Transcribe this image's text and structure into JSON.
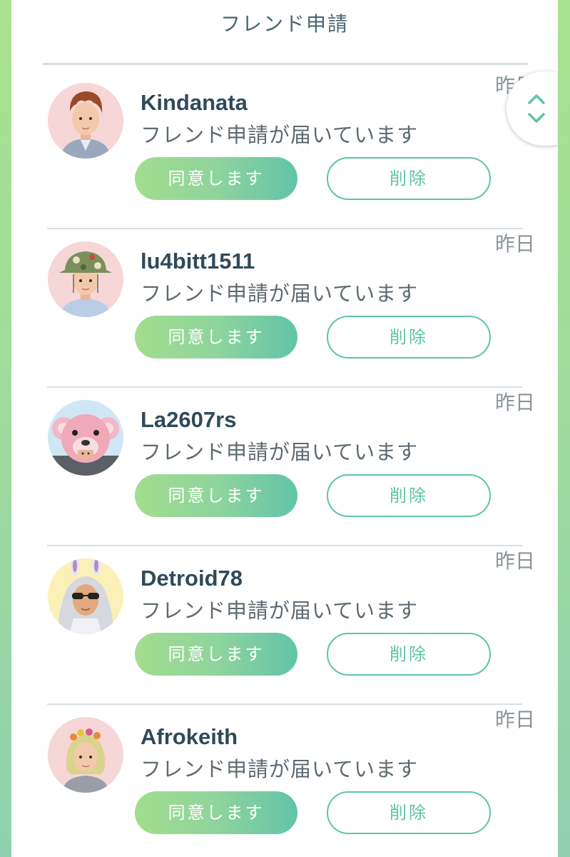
{
  "header": {
    "title": "フレンド申請"
  },
  "requests": [
    {
      "username": "Kindanata",
      "message": "フレンド申請が届いています",
      "time": "昨日",
      "accept_label": "同意します",
      "delete_label": "削除",
      "avatar_bg": "#f6d6d6"
    },
    {
      "username": "lu4bitt1511",
      "message": "フレンド申請が届いています",
      "time": "昨日",
      "accept_label": "同意します",
      "delete_label": "削除",
      "avatar_bg": "#f6d6d6"
    },
    {
      "username": "La2607rs",
      "message": "フレンド申請が届いています",
      "time": "昨日",
      "accept_label": "同意します",
      "delete_label": "削除",
      "avatar_bg": "#cfe7f5"
    },
    {
      "username": "Detroid78",
      "message": "フレンド申請が届いています",
      "time": "昨日",
      "accept_label": "同意します",
      "delete_label": "削除",
      "avatar_bg": "#fbf1b8"
    },
    {
      "username": "Afrokeith",
      "message": "フレンド申請が届いています",
      "time": "昨日",
      "accept_label": "同意します",
      "delete_label": "削除",
      "avatar_bg": "#f6d6d6"
    }
  ],
  "colors": {
    "accent": "#5fc4a4",
    "accept_gradient_start": "#a2dd8e",
    "accept_gradient_end": "#62c4a8",
    "username": "#2f4a5a"
  }
}
